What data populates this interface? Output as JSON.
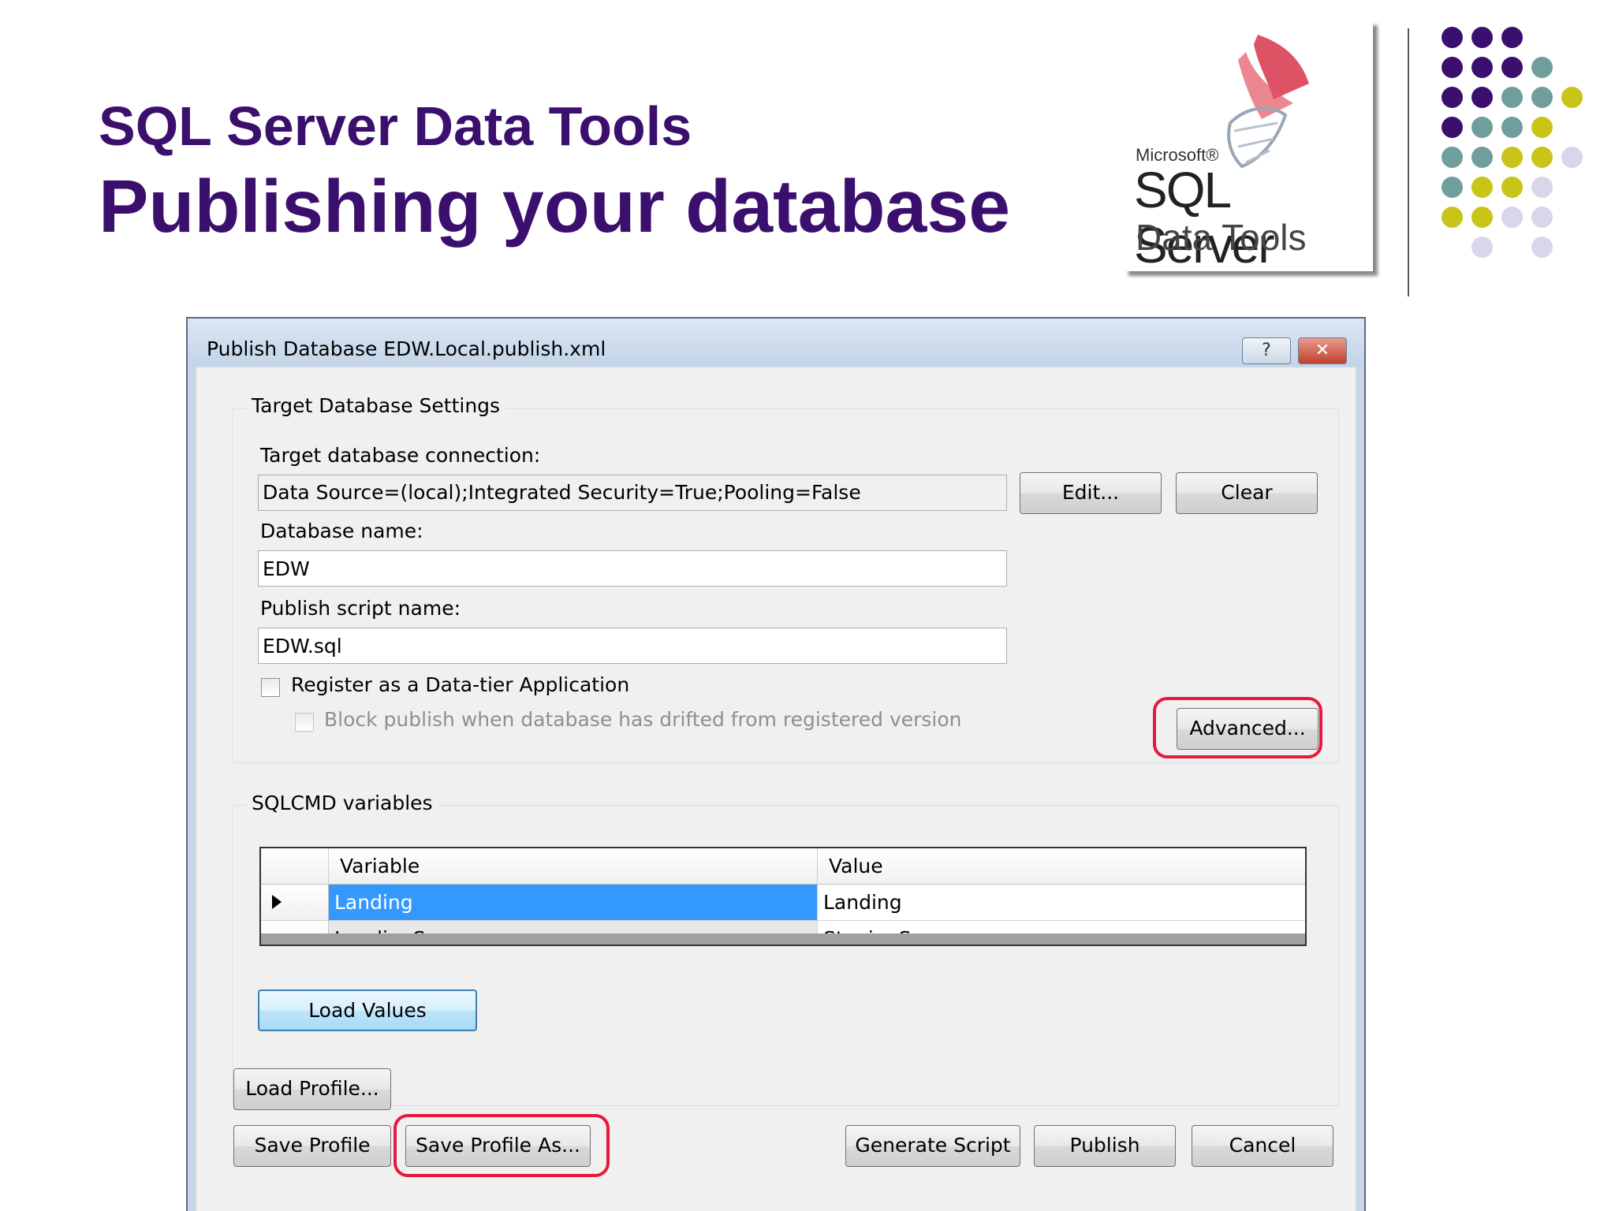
{
  "slide": {
    "title": "SQL Server Data Tools",
    "subtitle": "Publishing your database"
  },
  "logo": {
    "microsoft": "Microsoft®",
    "product": "SQL Server",
    "suffix": "Data Tools"
  },
  "decor": {
    "dot_rows": [
      [
        "purple",
        "purple",
        "purple",
        null,
        null
      ],
      [
        "purple",
        "purple",
        "purple",
        "teal",
        null
      ],
      [
        "purple",
        "purple",
        "teal",
        "teal",
        "lime"
      ],
      [
        "purple",
        "teal",
        "teal",
        "lime",
        null
      ],
      [
        "teal",
        "teal",
        "lime",
        "lime",
        "lavender"
      ],
      [
        "teal",
        "lime",
        "lime",
        "lavender",
        null
      ],
      [
        "lime",
        "lime",
        "lavender",
        "lavender",
        null
      ],
      [
        null,
        "lavender",
        null,
        "lavender",
        null
      ]
    ],
    "colors": {
      "purple": "#3b0f6e",
      "teal": "#6f9e9c",
      "lime": "#c8c418",
      "lavender": "#d9d5ea"
    }
  },
  "dialog": {
    "title": "Publish Database EDW.Local.publish.xml",
    "help_glyph": "?",
    "close_glyph": "✕",
    "target_group": {
      "label": "Target Database Settings",
      "connection_label": "Target database connection:",
      "connection_value": "Data Source=(local);Integrated Security=True;Pooling=False",
      "edit_button": "Edit...",
      "clear_button": "Clear",
      "database_name_label": "Database name:",
      "database_name_value": "EDW",
      "script_name_label": "Publish script name:",
      "script_name_value": "EDW.sql",
      "register_label": "Register as a Data-tier Application",
      "block_label": "Block publish when database has drifted from registered version",
      "advanced_button": "Advanced..."
    },
    "sqlcmd_group": {
      "label": "SQLCMD variables",
      "columns": [
        "Variable",
        "Value"
      ],
      "rows": [
        {
          "variable": "Landing",
          "value": "Landing"
        },
        {
          "variable": "LandingServer",
          "value": "StagingServer"
        }
      ],
      "load_values_button": "Load Values"
    },
    "buttons": {
      "load_profile": "Load Profile...",
      "save_profile": "Save Profile",
      "save_profile_as": "Save Profile As...",
      "generate_script": "Generate Script",
      "publish": "Publish",
      "cancel": "Cancel"
    },
    "accent_colors": {
      "highlight": "#e8183d",
      "selection": "#3399ff"
    }
  }
}
